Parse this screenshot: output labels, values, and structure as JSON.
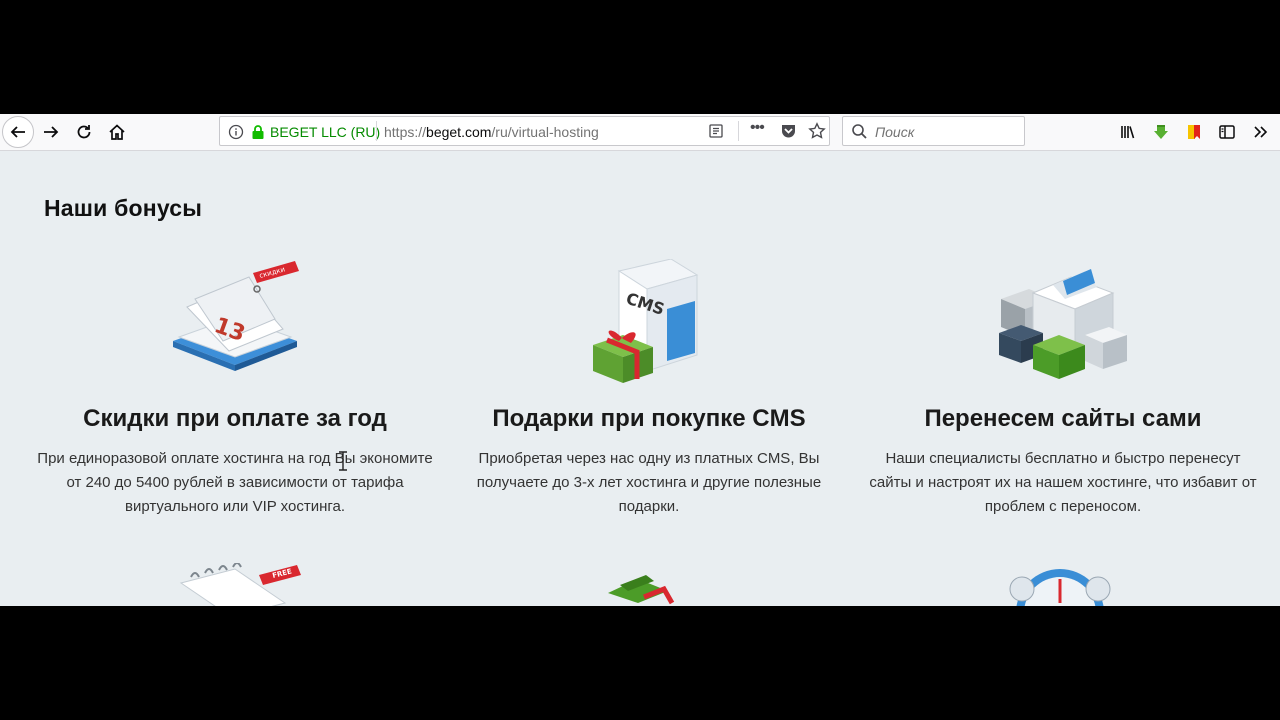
{
  "browser": {
    "url_owner": "BEGET LLC (RU)",
    "url_prefix": "https://",
    "url_domain": "beget.com",
    "url_path": "/ru/virtual-hosting",
    "search_placeholder": "Поиск",
    "more_label": "•••"
  },
  "page": {
    "section_title": "Наши бонусы",
    "cards": [
      {
        "title": "Скидки при оплате за год",
        "text": "При единоразовой оплате хостинга на год Вы экономите от 240 до 5400 рублей в зависимости от тарифа виртуального или VIP хостинга.",
        "badge": "скидки",
        "calendar_number": "13"
      },
      {
        "title": "Подарки при покупке CMS",
        "text": "Приобретая через нас одну из платных CMS, Вы получаете до 3-х лет хостинга и другие полезные подарки.",
        "box_label": "CMS"
      },
      {
        "title": "Перенесем сайты сами",
        "text": "Наши специалисты бесплатно и быстро перенесут сайты и настроят их на нашем хостинге, что избавит от проблем с переносом."
      }
    ],
    "row2_badge": "FREE"
  },
  "colors": {
    "page_bg": "#e9eef1",
    "secure_green": "#058b00",
    "accent_red": "#d9282f"
  }
}
